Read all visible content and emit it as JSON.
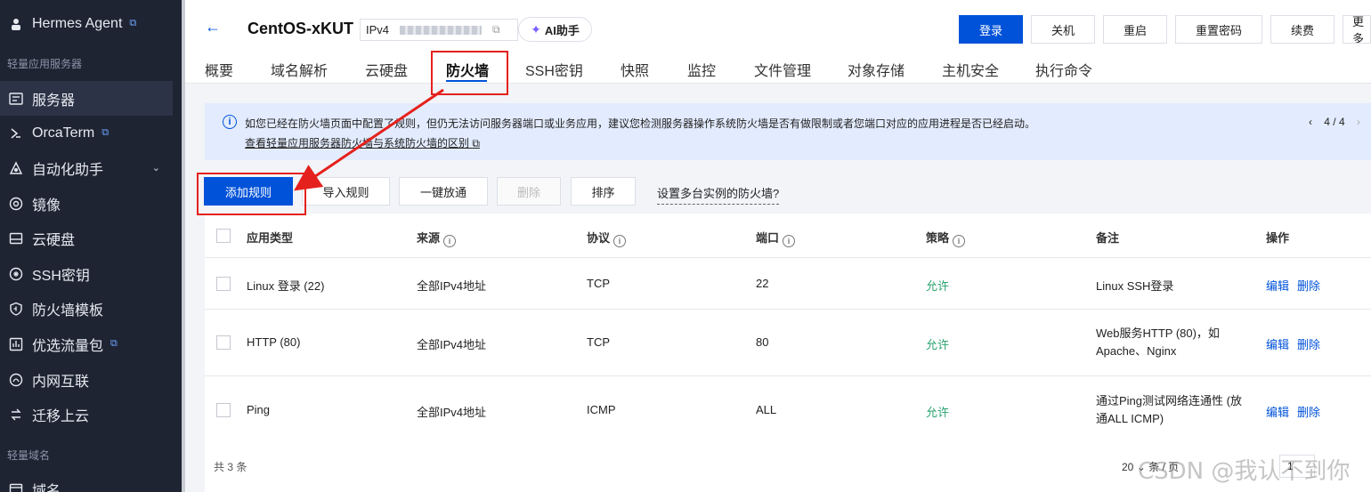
{
  "sidebar": {
    "top_item": {
      "label": "Hermes Agent"
    },
    "section1": "轻量应用服务器",
    "items": [
      {
        "label": "服务器",
        "icon": "server-icon"
      },
      {
        "label": "OrcaTerm",
        "icon": "terminal-icon"
      },
      {
        "label": "自动化助手",
        "icon": "automation-icon"
      },
      {
        "label": "镜像",
        "icon": "image-icon"
      },
      {
        "label": "云硬盘",
        "icon": "disk-icon"
      },
      {
        "label": "SSH密钥",
        "icon": "key-icon"
      },
      {
        "label": "防火墙模板",
        "icon": "shield-icon"
      },
      {
        "label": "优选流量包",
        "icon": "traffic-icon"
      },
      {
        "label": "内网互联",
        "icon": "network-icon"
      },
      {
        "label": "迁移上云",
        "icon": "migrate-icon"
      }
    ],
    "section2": "轻量域名",
    "bottom_item": {
      "label": "域名",
      "icon": "domain-icon"
    }
  },
  "header": {
    "instance_name": "CentOS-xKUT",
    "ip_type": "IPv4",
    "ai_label": "AI助手",
    "actions": [
      "登录",
      "关机",
      "重启",
      "重置密码",
      "续费",
      "更多"
    ]
  },
  "tabs": [
    "概要",
    "域名解析",
    "云硬盘",
    "防火墙",
    "SSH密钥",
    "快照",
    "监控",
    "文件管理",
    "对象存储",
    "主机安全",
    "执行命令"
  ],
  "active_tab": "防火墙",
  "notice": {
    "text": "如您已经在防火墙页面中配置了规则，但仍无法访问服务器端口或业务应用，建议您检测服务器操作系统防火墙是否有做限制或者您端口对应的应用进程是否已经启动。",
    "link": "查看轻量应用服务器防火墙与系统防火墙的区别",
    "pager": "4 / 4"
  },
  "toolbar": {
    "add": "添加规则",
    "import": "导入规则",
    "open_all": "一键放通",
    "delete": "删除",
    "sort": "排序",
    "multi": "设置多台实例的防火墙?"
  },
  "table": {
    "headers": [
      "应用类型",
      "来源",
      "协议",
      "端口",
      "策略",
      "备注",
      "操作"
    ],
    "rows": [
      {
        "type": "Linux 登录 (22)",
        "source": "全部IPv4地址",
        "protocol": "TCP",
        "port": "22",
        "policy": "允许",
        "note": "Linux SSH登录",
        "edit": "编辑",
        "delete": "删除"
      },
      {
        "type": "HTTP (80)",
        "source": "全部IPv4地址",
        "protocol": "TCP",
        "port": "80",
        "policy": "允许",
        "note": "Web服务HTTP (80)，如 Apache、Nginx",
        "edit": "编辑",
        "delete": "删除"
      },
      {
        "type": "Ping",
        "source": "全部IPv4地址",
        "protocol": "ICMP",
        "port": "ALL",
        "policy": "允许",
        "note": "通过Ping测试网络连通性 (放通ALL ICMP)",
        "edit": "编辑",
        "delete": "删除"
      }
    ]
  },
  "footer": {
    "total": "共 3 条",
    "page_size": "20",
    "page_unit": "条 / 页",
    "page": "1"
  },
  "watermark": "CSDN @我认不到你"
}
